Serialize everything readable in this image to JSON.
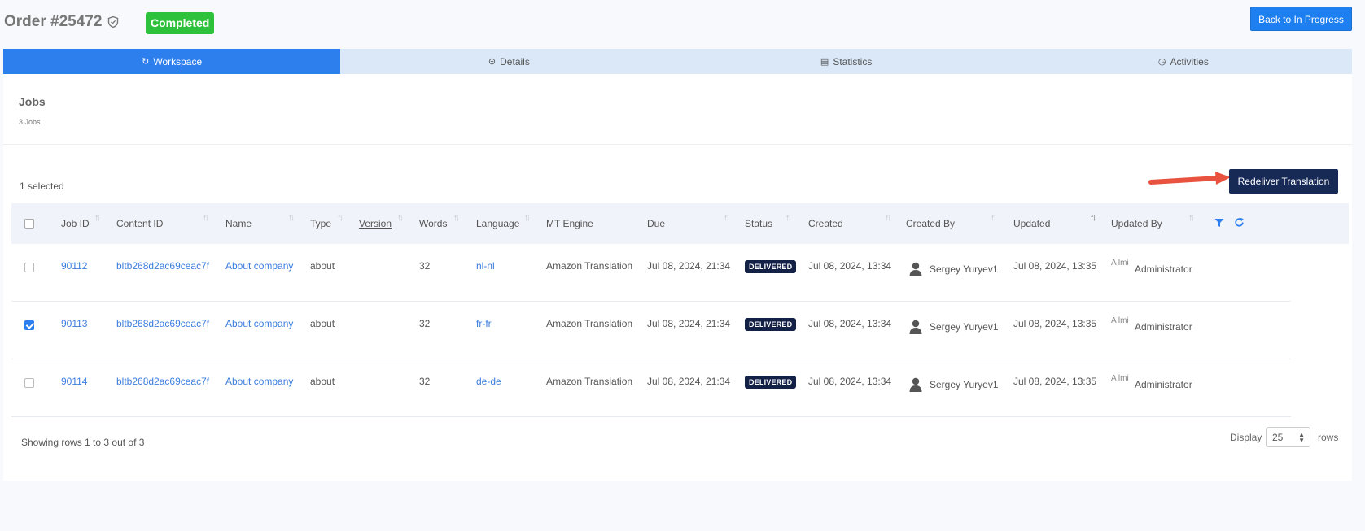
{
  "header": {
    "order_title": "Order #25472",
    "status": "Completed",
    "back_button": "Back to In Progress"
  },
  "tabs": [
    {
      "label": "Workspace",
      "icon": "share-icon",
      "active": true
    },
    {
      "label": "Details",
      "icon": "minus-circle-icon",
      "active": false
    },
    {
      "label": "Statistics",
      "icon": "chart-icon",
      "active": false
    },
    {
      "label": "Activities",
      "icon": "history-icon",
      "active": false
    }
  ],
  "jobs": {
    "title": "Jobs",
    "count": "3 Jobs",
    "selected": "1 selected",
    "redeliver_button": "Redeliver Translation"
  },
  "table": {
    "columns": [
      "Job ID",
      "Content ID",
      "Name",
      "Type",
      "Version",
      "Words",
      "Language",
      "MT Engine",
      "Due",
      "Status",
      "Created",
      "Created By",
      "Updated",
      "Updated By"
    ],
    "rows": [
      {
        "checked": false,
        "job_id": "90112",
        "content_id": "bltb268d2ac69ceac7f",
        "name": "About company",
        "type": "about",
        "version": "",
        "words": "32",
        "language": "nl-nl",
        "mt_engine": "Amazon Translation",
        "due": "Jul 08, 2024, 21:34",
        "status": "DELIVERED",
        "created": "Jul 08, 2024, 13:34",
        "created_by": "Sergey Yuryev1",
        "updated": "Jul 08, 2024, 13:35",
        "updated_by": "Administrator",
        "avatar_alt": "A lmi"
      },
      {
        "checked": true,
        "job_id": "90113",
        "content_id": "bltb268d2ac69ceac7f",
        "name": "About company",
        "type": "about",
        "version": "",
        "words": "32",
        "language": "fr-fr",
        "mt_engine": "Amazon Translation",
        "due": "Jul 08, 2024, 21:34",
        "status": "DELIVERED",
        "created": "Jul 08, 2024, 13:34",
        "created_by": "Sergey Yuryev1",
        "updated": "Jul 08, 2024, 13:35",
        "updated_by": "Administrator",
        "avatar_alt": "A lmi"
      },
      {
        "checked": false,
        "job_id": "90114",
        "content_id": "bltb268d2ac69ceac7f",
        "name": "About company",
        "type": "about",
        "version": "",
        "words": "32",
        "language": "de-de",
        "mt_engine": "Amazon Translation",
        "due": "Jul 08, 2024, 21:34",
        "status": "DELIVERED",
        "created": "Jul 08, 2024, 13:34",
        "created_by": "Sergey Yuryev1",
        "updated": "Jul 08, 2024, 13:35",
        "updated_by": "Administrator",
        "avatar_alt": "A lmi"
      }
    ]
  },
  "footer": {
    "showing": "Showing rows 1 to 3 out of 3",
    "display_label": "Display",
    "page_size": "25",
    "rows_label": "rows"
  },
  "colors": {
    "primary": "#2d7fee",
    "completed": "#2ec23c",
    "navy": "#172a55",
    "arrow": "#e8533f"
  }
}
